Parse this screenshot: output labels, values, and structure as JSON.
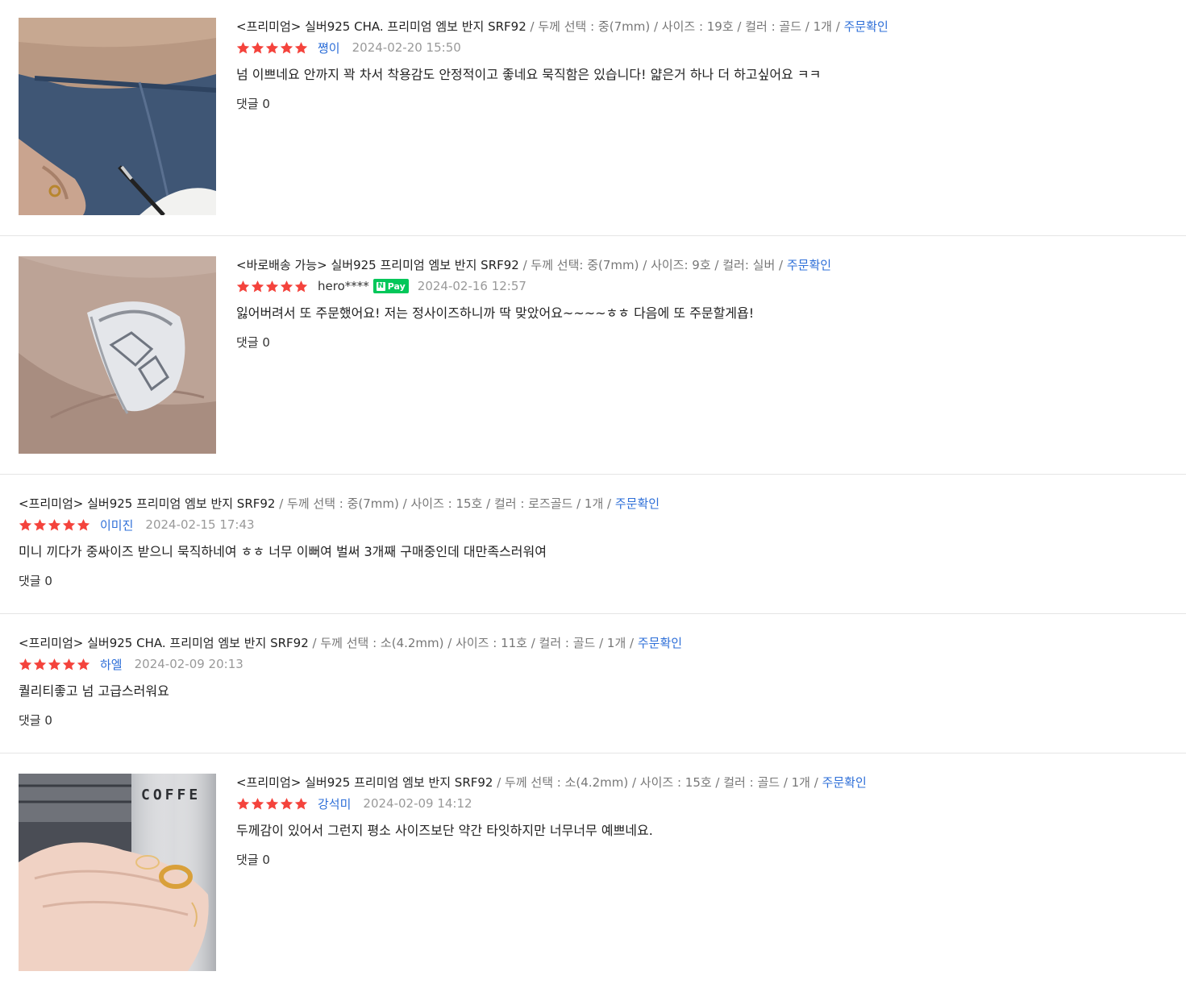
{
  "reviews": [
    {
      "product_name": "<프리미엄> 실버925 CHA. 프리미엄 엠보 반지 SRF92",
      "options": " / 두께 선택 : 중(7mm) / 사이즈 : 19호 / 컬러 : 골드 / 1개 / ",
      "order_link": "주문확인",
      "rating": 5,
      "user": "쪙이",
      "date": "2024-02-20 15:50",
      "text": "넘 이쁘네요 안까지 꽉 차서 착용감도 안정적이고 좋네요 묵직함은 있습니다! 얇은거 하나 더 하고싶어요 ㅋㅋ",
      "comments": "댓글 0"
    },
    {
      "product_name": "<바로배송 가능> 실버925 프리미엄 엠보 반지 SRF92",
      "options": " / 두께 선택: 중(7mm) / 사이즈: 9호 / 컬러: 실버 / ",
      "order_link": "주문확인",
      "rating": 5,
      "user": "hero****",
      "badge": "Pay",
      "date": "2024-02-16 12:57",
      "text": "잃어버려서 또 주문했어요! 저는 정사이즈하니까 딱 맞았어요~~~~ㅎㅎ 다음에 또 주문할게욥!",
      "comments": "댓글 0"
    },
    {
      "product_name": "<프리미엄> 실버925 프리미엄 엠보 반지 SRF92",
      "options": " / 두께 선택 : 중(7mm) / 사이즈 : 15호 / 컬러 : 로즈골드 / 1개 / ",
      "order_link": "주문확인",
      "rating": 5,
      "user": "이미진",
      "date": "2024-02-15 17:43",
      "text": "미니 끼다가 중싸이즈 받으니 묵직하네여 ㅎㅎ 너무 이뻐여 벌써 3개째 구매중인데 대만족스러워여",
      "comments": "댓글 0"
    },
    {
      "product_name": "<프리미엄> 실버925 CHA. 프리미엄 엠보 반지 SRF92",
      "options": " / 두께 선택 : 소(4.2mm) / 사이즈 : 11호 / 컬러 : 골드 / 1개 / ",
      "order_link": "주문확인",
      "rating": 5,
      "user": "하엘",
      "date": "2024-02-09 20:13",
      "text": "퀄리티좋고 넘 고급스러워요",
      "comments": "댓글 0"
    },
    {
      "product_name": "<프리미엄> 실버925 프리미엄 엠보 반지 SRF92",
      "options": " / 두께 선택 : 소(4.2mm) / 사이즈 : 15호 / 컬러 : 골드 / 1개 / ",
      "order_link": "주문확인",
      "rating": 5,
      "user": "강석미",
      "date": "2024-02-09 14:12",
      "text": "두께감이 있어서 그런지 평소 사이즈보단 약간 타잇하지만 너무너무 예쁘네요.",
      "comments": "댓글 0",
      "photo_text": "COFFE"
    }
  ],
  "colors": {
    "star": "#f4433c",
    "link": "#2e6fd8",
    "npay": "#03c75a"
  },
  "icons": {
    "star": "star-icon"
  }
}
